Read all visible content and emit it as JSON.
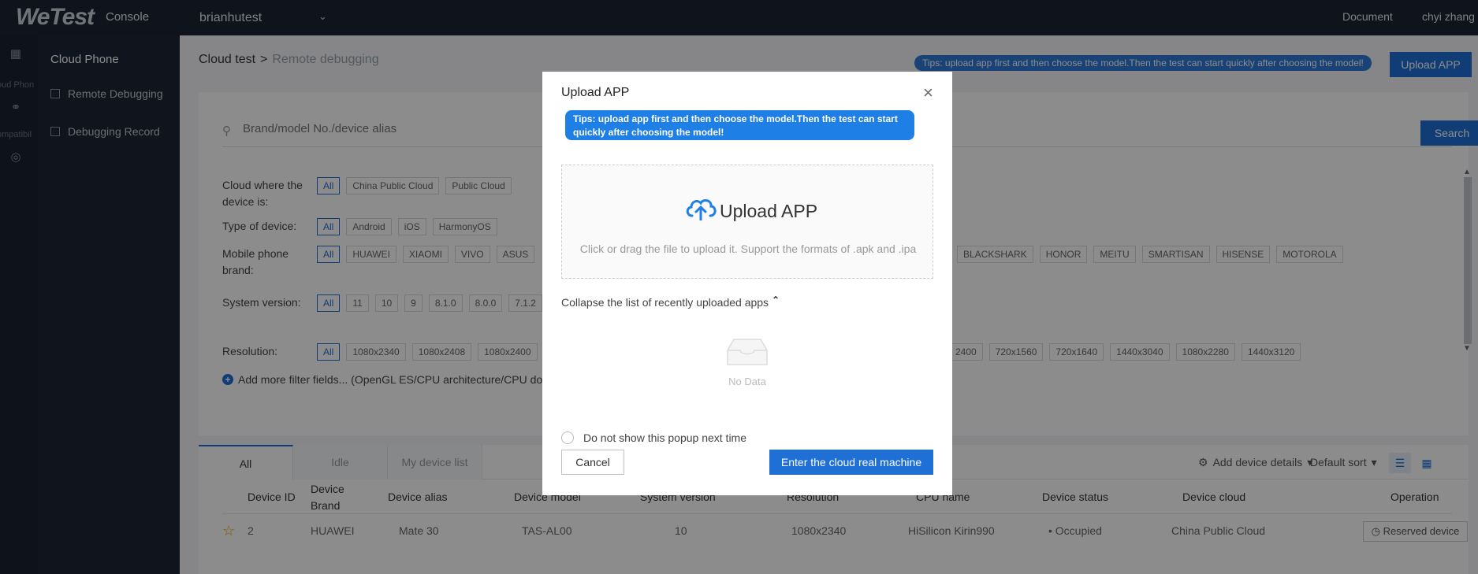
{
  "topbar": {
    "logo": "WeTest",
    "console": "Console",
    "project": "brianhutest",
    "document": "Document",
    "user": "chyi zhang"
  },
  "rail": {
    "items": [
      "oud Phon",
      "ompatibil"
    ]
  },
  "subnav": {
    "title": "Cloud Phone",
    "items": [
      "Remote Debugging",
      "Debugging Record"
    ]
  },
  "breadcrumb": {
    "root": "Cloud test",
    "separator": ">",
    "current": "Remote debugging"
  },
  "header": {
    "tips": "Tips: upload app first and then choose the model.Then the test can start quickly after choosing the model!",
    "upload_label": "Upload APP"
  },
  "search": {
    "placeholder": "Brand/model No./device alias",
    "button": "Search"
  },
  "filters": {
    "cloud": {
      "label": "Cloud where the device is:",
      "options": [
        "All",
        "China Public Cloud",
        "Public Cloud"
      ]
    },
    "type": {
      "label": "Type of device:",
      "options": [
        "All",
        "Android",
        "iOS",
        "HarmonyOS"
      ]
    },
    "brand": {
      "label": "Mobile phone brand:",
      "options": [
        "All",
        "HUAWEI",
        "XIAOMI",
        "VIVO",
        "ASUS"
      ],
      "options_right": [
        "BLACKSHARK",
        "HONOR",
        "MEITU",
        "SMARTISAN",
        "HISENSE",
        "MOTOROLA"
      ]
    },
    "version": {
      "label": "System version:",
      "options": [
        "All",
        "11",
        "10",
        "9",
        "8.1.0",
        "8.0.0",
        "7.1.2"
      ]
    },
    "resolution": {
      "label": "Resolution:",
      "options": [
        "All",
        "1080x2340",
        "1080x2408",
        "1080x2400"
      ],
      "options_right": [
        "2400",
        "720x1560",
        "720x1640",
        "1440x3040",
        "1080x2280",
        "1440x3120"
      ]
    },
    "more": "Add more filter fields... (OpenGL ES/CPU architecture/CPU dom"
  },
  "tabs": [
    "All",
    "Idle",
    "My device list"
  ],
  "list_tools": {
    "add_details": "Add device details",
    "sort": "Default sort"
  },
  "table": {
    "headers": [
      "Device ID",
      "Device Brand",
      "Device alias",
      "Device model",
      "System version",
      "Resolution",
      "CPU name",
      "Device status",
      "Device cloud",
      "Operation"
    ],
    "rows": [
      {
        "id": "2",
        "brand": "HUAWEI",
        "alias": "Mate 30",
        "model": "TAS-AL00",
        "version": "10",
        "resolution": "1080x2340",
        "cpu": "HiSilicon Kirin990",
        "status": "Occupied",
        "cloud": "China Public Cloud",
        "operation": "Reserved device"
      }
    ]
  },
  "modal": {
    "title": "Upload APP",
    "tip": "Tips: upload app first and then choose the model.Then the test can start quickly after choosing the model!",
    "dropzone_title": "Upload APP",
    "dropzone_desc": "Click or drag the file to upload it. Support the formats of .apk and .ipa",
    "collapse": "Collapse the list of recently uploaded apps",
    "no_data": "No Data",
    "dont_show": "Do not show this popup next time",
    "cancel": "Cancel",
    "enter": "Enter the cloud real machine"
  },
  "colors": {
    "primary": "#1e6fd6",
    "topbar": "#1c2433",
    "star": "#e8a400"
  }
}
